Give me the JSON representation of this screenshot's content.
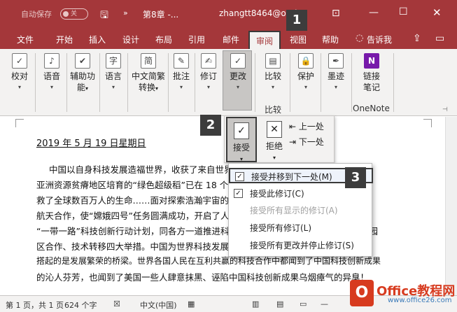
{
  "titlebar": {
    "autosave_label": "自动保存",
    "autosave_state": "关",
    "doc_title": "第8章 -...",
    "user": "zhangtt8464@outlo",
    "user_tail": "m"
  },
  "menu_tabs": [
    "文件",
    "开始",
    "插入",
    "设计",
    "布局",
    "引用",
    "邮件",
    "审阅",
    "视图",
    "帮助"
  ],
  "active_tab": "审阅",
  "tell_me": "告诉我",
  "ribbon": {
    "buttons": [
      {
        "label": "校对",
        "icon": "abc-check-icon",
        "glyph": "✓"
      },
      {
        "label": "语音",
        "icon": "speaker-icon",
        "glyph": "♪"
      },
      {
        "label": "辅助功",
        "label2": "能",
        "icon": "accessibility-icon",
        "glyph": "✔"
      },
      {
        "label": "语言",
        "icon": "language-icon",
        "glyph": "字"
      },
      {
        "label": "中文简繁",
        "label2": "转换",
        "icon": "chinese-convert-icon",
        "glyph": "简"
      },
      {
        "label": "批注",
        "icon": "comment-icon",
        "glyph": "✎"
      },
      {
        "label": "修订",
        "icon": "track-changes-icon",
        "glyph": "✍"
      },
      {
        "label": "更改",
        "icon": "changes-icon",
        "glyph": "✓"
      },
      {
        "label": "比较",
        "icon": "compare-icon",
        "glyph": "▤"
      },
      {
        "label": "保护",
        "icon": "protect-icon",
        "glyph": "🔒"
      },
      {
        "label": "墨迹",
        "icon": "ink-icon",
        "glyph": "✒"
      },
      {
        "label": "链接",
        "label2": "笔记",
        "icon": "onenote-icon",
        "glyph": "N"
      }
    ],
    "group_compare": "比较",
    "group_onenote": "OneNote"
  },
  "dropdown": {
    "accept": "接受",
    "reject": "拒绝",
    "prev": "上一处",
    "next": "下一处"
  },
  "menu_items": [
    {
      "label": "接受并移到下一处(M)",
      "disabled": false
    },
    {
      "label": "接受此修订(C)",
      "disabled": false
    },
    {
      "label": "接受所有显示的修订(A)",
      "disabled": true
    },
    {
      "label": "接受所有修订(L)",
      "disabled": false
    },
    {
      "label": "接受所有更改并停止修订(S)",
      "disabled": false
    }
  ],
  "document": {
    "date": "2019 年 5 月 19 日星期日",
    "lines": [
      "中国以自身科技发展造福世界，收获了来自世界各地的赞誉。中国为非洲和",
      "亚洲资源贫瘠地区培育的“绿色超级稻”已在 18 个国家示范推广，青蒿素挽",
      "救了全球数百万人的生命……面对探索浩瀚宇宙的共同梦想，中国推动国际",
      "航天合作，使“嫦娥四号”任务圆满成功，开启了人类探月新篇章，实施共建",
      "“一带一路”科技创新行动计划，同各方一道推进科技人文交流、共建联合实验室、科技园",
      "区合作、技术转移四大举措。中国为世界科技发展贡献中国智慧，技术为世界",
      "搭起的是发展繁荣的桥梁。世界各国人民在互利共赢的科技合作中都闻到了中国科技创新成果",
      "的沁人芬芳，也闻到了美国一些人肆意抹黑、诬陷中国科技创新成果乌烟瘴气的异臭！"
    ]
  },
  "statusbar": {
    "page": "第 1 页，共 1 页",
    "words": "624 个字",
    "lang": "中文(中国)"
  },
  "badges": [
    "1",
    "2",
    "3"
  ],
  "watermark": {
    "title": "Office教程网",
    "sub": "www.office26.com"
  },
  "colors": {
    "accent": "#a4373a"
  }
}
